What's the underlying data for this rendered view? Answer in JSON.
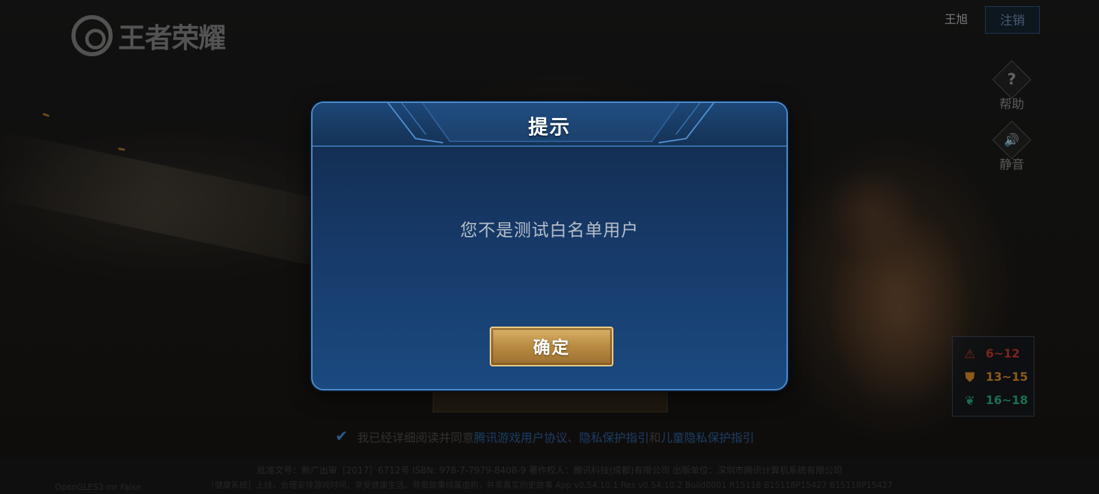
{
  "logo": {
    "text": "王者荣耀"
  },
  "header": {
    "username": "王旭",
    "logout_label": "注销"
  },
  "side": {
    "help": {
      "icon": "?",
      "label": "帮助"
    },
    "mute": {
      "icon": "🔊",
      "label": "静音"
    }
  },
  "age_rating": [
    {
      "icon": "warning-triangle-icon",
      "glyph": "⚠",
      "range": "6~12",
      "color": "#c0392b"
    },
    {
      "icon": "shield-icon",
      "glyph": "⛊",
      "range": "13~15",
      "color": "#d88a2a"
    },
    {
      "icon": "leaf-icon",
      "glyph": "❦",
      "range": "16~18",
      "color": "#2aa87a"
    }
  ],
  "agreement": {
    "checked": true,
    "prefix": "我已经详细阅读并同意",
    "link1": "腾讯游戏用户协议",
    "sep": "、",
    "link2": "隐私保护指引",
    "and": "和",
    "link3": "儿童隐私保护指引"
  },
  "footer": {
    "line1": "批准文号：新广出审［2017］6712号 ISBN: 978-7-7979-8408-9 著作权人：腾讯科技(成都)有限公司 出版单位：深圳市腾讯计算机系统有限公司",
    "line2": "［健康系统］上线，合理安排游戏时间，享受健康生活。背景故事纯属虚构，并非真实的史故事 App v0.54.10.1 Res v0.54.10.2 Build0001 R15118 B15118P15427 B15118P15427",
    "gl": "OpenGLES3 mr False"
  },
  "dialog": {
    "title": "提示",
    "message": "您不是测试白名单用户",
    "confirm_label": "确定"
  }
}
